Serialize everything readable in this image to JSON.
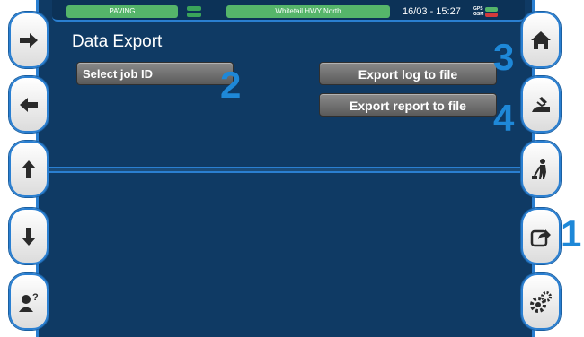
{
  "header": {
    "mode_label": "PAVING",
    "road_label": "Whitetail HWY North",
    "datetime": "16/03 - 15:27",
    "gps_label": "GPS",
    "gsm_label": "GSM",
    "status_colors": {
      "ok": "#55b56a",
      "warn": "#d33b3b"
    }
  },
  "page": {
    "title": "Data Export"
  },
  "buttons": {
    "select_job": "Select job ID",
    "export_log": "Export log to file",
    "export_report": "Export report to file"
  },
  "callouts": {
    "n1": "1",
    "n2": "2",
    "n3": "3",
    "n4": "4"
  },
  "left_nav": [
    {
      "icon": "arrow-right-icon"
    },
    {
      "icon": "arrow-left-icon"
    },
    {
      "icon": "arrow-up-icon"
    },
    {
      "icon": "arrow-down-icon"
    },
    {
      "icon": "user-help-icon"
    }
  ],
  "right_nav": [
    {
      "icon": "home-icon"
    },
    {
      "icon": "paver-icon"
    },
    {
      "icon": "worker-icon"
    },
    {
      "icon": "export-icon"
    },
    {
      "icon": "settings-icon"
    }
  ]
}
